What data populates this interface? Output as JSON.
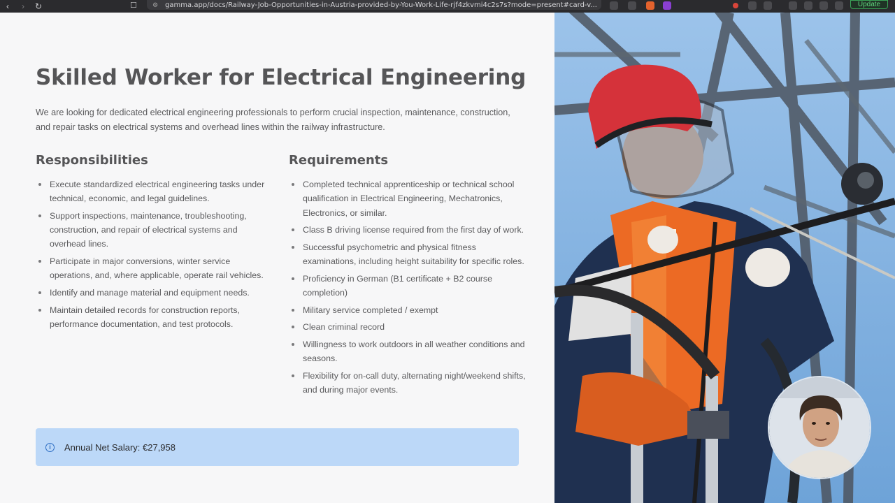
{
  "browser": {
    "url": "gamma.app/docs/Railway-Job-Opportunities-in-Austria-provided-by-You-Work-Life-rjf4zkvmi4c2s7s?mode=present#card-v...",
    "update_label": "Update"
  },
  "slide": {
    "title": "Skilled Worker for Electrical Engineering",
    "intro": "We are looking for dedicated electrical engineering professionals to perform crucial inspection, maintenance, construction, and repair tasks on electrical systems and overhead lines within the railway infrastructure.",
    "responsibilities": {
      "heading": "Responsibilities",
      "items": [
        "Execute standardized electrical engineering tasks under technical, economic, and legal guidelines.",
        "Support inspections, maintenance, troubleshooting, construction, and repair of electrical systems and overhead lines.",
        "Participate in major conversions, winter service operations, and, where applicable, operate rail vehicles.",
        "Identify and manage material and equipment needs.",
        "Maintain detailed records for construction reports, performance documentation, and test protocols."
      ]
    },
    "requirements": {
      "heading": "Requirements",
      "items": [
        "Completed technical apprenticeship or technical school qualification in Electrical Engineering, Mechatronics, Electronics, or similar.",
        "Class B driving license required from the first day of work.",
        "Successful psychometric and physical fitness examinations, including height suitability for specific roles.",
        "Proficiency in German (B1 certificate + B2 course completion)",
        "Military service completed / exempt",
        "Clean criminal record",
        "Willingness to work outdoors in all weather conditions and seasons.",
        "Flexibility for on-call duty, alternating night/weekend shifts, and during major events."
      ]
    },
    "salary": "Annual Net Salary: €27,958"
  },
  "icons": {
    "info": "info-icon",
    "photo": "electrician-photo",
    "webcam": "presenter-webcam"
  },
  "colors": {
    "salary_bg": "#bcd8f8",
    "info_blue": "#2f6fc4",
    "update_green": "#5fd67e"
  }
}
